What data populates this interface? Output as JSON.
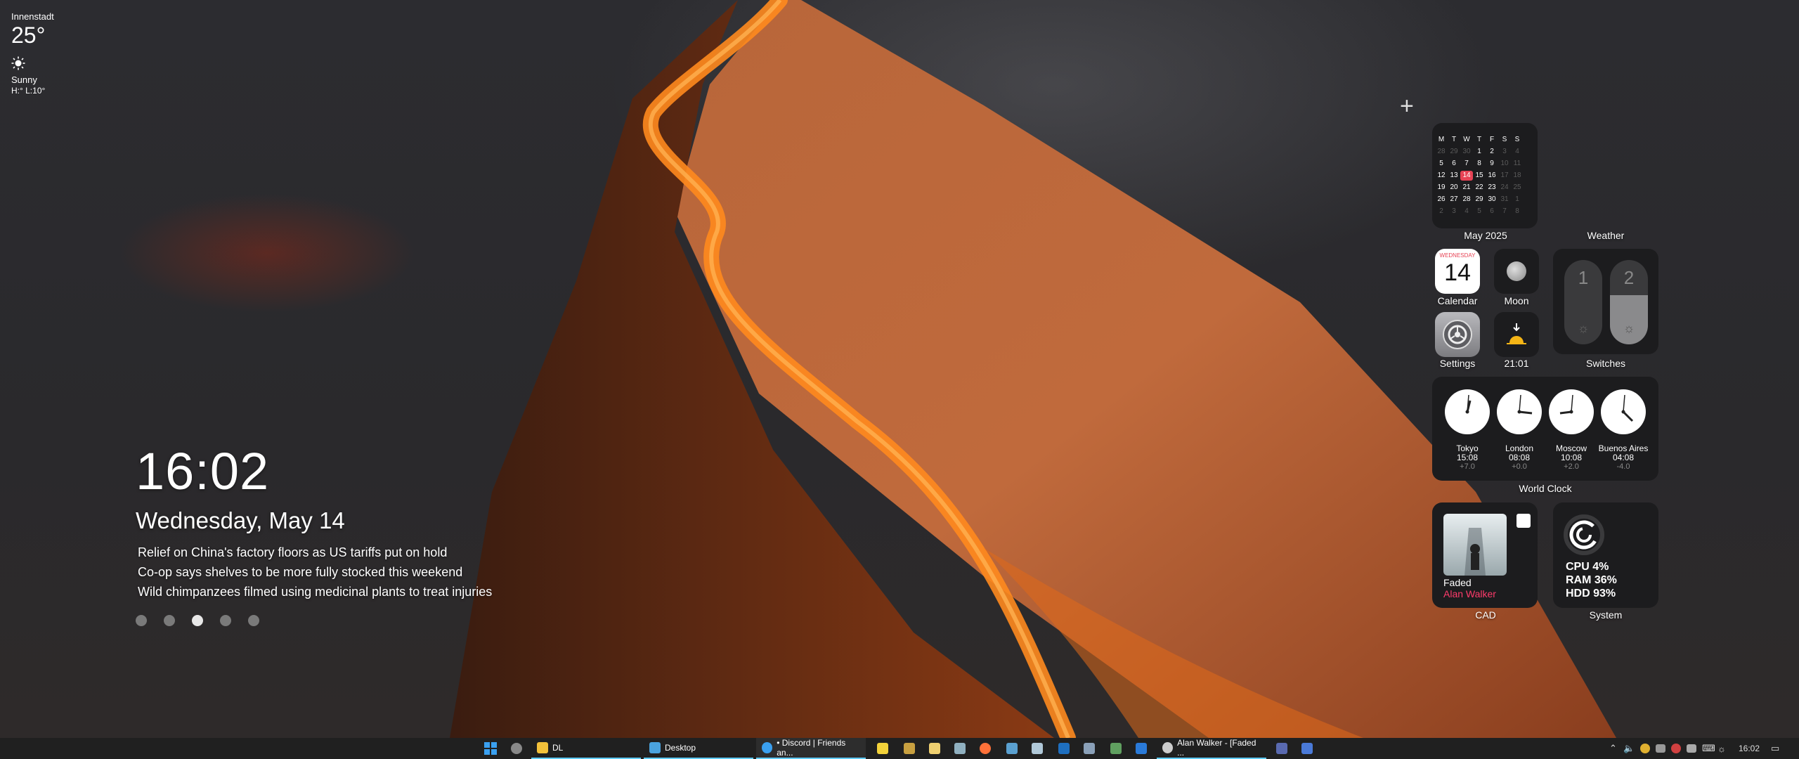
{
  "clock": {
    "time": "16:02",
    "date": "Wednesday, May 14"
  },
  "headlines": [
    "Relief on China's factory floors as US tariffs put on hold",
    "Co-op says shelves to be more fully stocked this weekend",
    "Wild chimpanzees filmed using medicinal plants to treat injuries"
  ],
  "pager": {
    "count": 5,
    "active_index": 2
  },
  "add_icon": "+",
  "calendar_widget": {
    "label": "May 2025",
    "weekdays": [
      "M",
      "T",
      "W",
      "T",
      "F",
      "S",
      "S"
    ],
    "rows": [
      [
        "28",
        "29",
        "30",
        "1",
        "2",
        "3",
        "4"
      ],
      [
        "5",
        "6",
        "7",
        "8",
        "9",
        "10",
        "11"
      ],
      [
        "12",
        "13",
        "14",
        "15",
        "16",
        "17",
        "18"
      ],
      [
        "19",
        "20",
        "21",
        "22",
        "23",
        "24",
        "25"
      ],
      [
        "26",
        "27",
        "28",
        "29",
        "30",
        "31",
        "1"
      ],
      [
        "2",
        "3",
        "4",
        "5",
        "6",
        "7",
        "8"
      ]
    ],
    "today": "14"
  },
  "weather": {
    "label": "Weather",
    "city": "Innenstadt",
    "temp": "25°",
    "condition": "Sunny",
    "hilo": "H:° L:10°",
    "icon": "sun-icon"
  },
  "apps": {
    "calendar": {
      "label": "Calendar",
      "weekday": "WEDNESDAY",
      "day": "14"
    },
    "moon": {
      "label": "Moon"
    },
    "settings": {
      "label": "Settings"
    },
    "sunset": {
      "label": "21:01"
    }
  },
  "switches": {
    "label": "Switches",
    "items": [
      "1",
      "2"
    ]
  },
  "world_clock": {
    "label": "World Clock",
    "cities": [
      {
        "name": "Tokyo",
        "time": "15:08",
        "offset": "+7.0"
      },
      {
        "name": "London",
        "time": "08:08",
        "offset": "+0.0"
      },
      {
        "name": "Moscow",
        "time": "10:08",
        "offset": "+2.0"
      },
      {
        "name": "Buenos Aires",
        "time": "04:08",
        "offset": "-4.0"
      }
    ]
  },
  "music": {
    "label": "CAD",
    "track": "Faded",
    "artist": "Alan Walker"
  },
  "system": {
    "label": "System",
    "cpu": "CPU 4%",
    "ram": "RAM 36%",
    "hdd": "HDD 93%"
  },
  "taskbar": {
    "folder": "DL",
    "desktop": "Desktop",
    "discord": "• Discord | Friends an...",
    "music": "Alan Walker - [Faded ...",
    "clock": "16:02"
  }
}
